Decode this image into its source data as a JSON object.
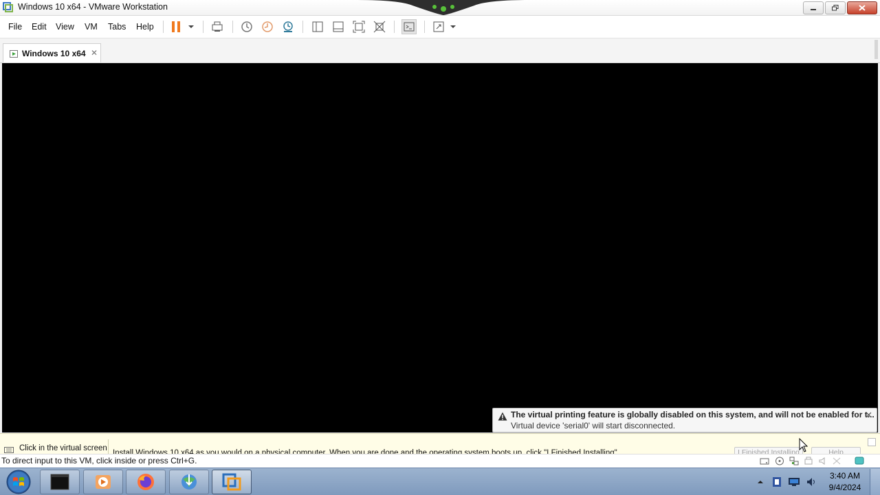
{
  "window": {
    "title": "Windows 10 x64 - VMware Workstation",
    "buttons": [
      "minimize",
      "restore",
      "close"
    ]
  },
  "menu": {
    "items": [
      "File",
      "Edit",
      "View",
      "VM",
      "Tabs",
      "Help"
    ]
  },
  "toolbar": {
    "icons": [
      "pause-icon",
      "dropdown-icon",
      "send-ctrl-alt-del-icon",
      "snapshot-icon",
      "revert-snapshot-icon",
      "snapshot-manager-icon",
      "library-icon",
      "thumbnail-bar-icon",
      "full-screen-icon",
      "unity-icon",
      "console-icon",
      "stretch-icon"
    ]
  },
  "tabs": [
    {
      "label": "Windows 10 x64",
      "close": "✕"
    }
  ],
  "notification": {
    "title": "The virtual printing feature is globally disabled on this system, and will not be enabled for t...",
    "subtitle": "Virtual device 'serial0' will start disconnected.",
    "close": "✕"
  },
  "hint_bar": {
    "click_label": "Click in the virtual screen",
    "message": "Install Windows 10 x64 as you would on a physical computer. When you are done and the operating system boots up, click \"I Finished Installing\".",
    "finished_button": "I Finished Installing",
    "help_button": "Help"
  },
  "status_bar": {
    "text": "To direct input to this VM, click inside or press Ctrl+G."
  },
  "taskbar": {
    "apps": [
      "terminal",
      "media-player",
      "firefox",
      "internet-download-manager",
      "vmware-workstation"
    ],
    "clock_time": "3:40 AM",
    "clock_date": "9/4/2024"
  },
  "colors": {
    "vm_screen": "#000000",
    "hint_bar_bg": "#fffde7",
    "pause_orange": "#f07a1f",
    "taskbar": "#8fa7c7"
  }
}
